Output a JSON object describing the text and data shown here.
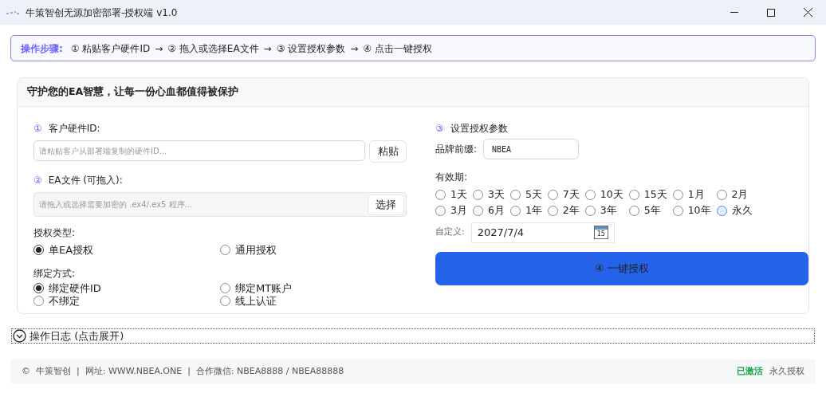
{
  "window": {
    "title": "牛策智创无源加密部署-授权端 v1.0"
  },
  "steps": {
    "label": "操作步骤:",
    "items": [
      "① 粘贴客户硬件ID",
      "→",
      "② 拖入或选择EA文件",
      "→",
      "③ 设置授权参数",
      "→",
      "④ 点击一键授权"
    ]
  },
  "card": {
    "title": "守护您的EA智慧，让每一份心血都值得被保护"
  },
  "hardware_id": {
    "number": "①",
    "label": "客户硬件ID:",
    "placeholder": "请粘贴客户从部署端复制的硬件ID...",
    "button": "粘贴"
  },
  "ea_file": {
    "number": "②",
    "label": "EA文件 (可拖入):",
    "placeholder": "请拖入或选择需要加密的 .ex4/.ex5 程序...",
    "button": "选择"
  },
  "license_type": {
    "label": "授权类型:",
    "options": [
      {
        "label": "单EA授权",
        "selected": true
      },
      {
        "label": "通用授权",
        "selected": false
      }
    ]
  },
  "binding": {
    "label": "绑定方式:",
    "options": [
      {
        "label": "绑定硬件ID",
        "selected": true
      },
      {
        "label": "绑定MT账户",
        "selected": false
      },
      {
        "label": "不绑定",
        "selected": false
      },
      {
        "label": "线上认证",
        "selected": false
      }
    ]
  },
  "params": {
    "number": "③",
    "label": "设置授权参数",
    "brand_label": "品牌前缀:",
    "brand_value": "NBEA"
  },
  "validity": {
    "label": "有效期:",
    "options": [
      {
        "label": "1天",
        "selected": false,
        "focused": false
      },
      {
        "label": "3天",
        "selected": false,
        "focused": false
      },
      {
        "label": "5天",
        "selected": false,
        "focused": false
      },
      {
        "label": "7天",
        "selected": false,
        "focused": false
      },
      {
        "label": "10天",
        "selected": false,
        "focused": false
      },
      {
        "label": "15天",
        "selected": false,
        "focused": false
      },
      {
        "label": "1月",
        "selected": false,
        "focused": false
      },
      {
        "label": "2月",
        "selected": false,
        "focused": false
      },
      {
        "label": "3月",
        "selected": false,
        "focused": false
      },
      {
        "label": "6月",
        "selected": false,
        "focused": false
      },
      {
        "label": "1年",
        "selected": false,
        "focused": false
      },
      {
        "label": "2年",
        "selected": false,
        "focused": false
      },
      {
        "label": "3年",
        "selected": false,
        "focused": false
      },
      {
        "label": "5年",
        "selected": false,
        "focused": false
      },
      {
        "label": "10年",
        "selected": false,
        "focused": false
      },
      {
        "label": "永久",
        "selected": false,
        "focused": true
      }
    ]
  },
  "custom": {
    "label": "自定义:",
    "value": "2027/7/4",
    "calendar_day": "15"
  },
  "authorize_button": "④ 一键授权",
  "log": {
    "label": "操作日志 (点击展开)",
    "expanded": false
  },
  "footer": {
    "text": "©  牛策智创  |  网址: WWW.NBEA.ONE  |  合作微信: NBEA8888 / NBEA88888",
    "status": "已激活",
    "license": "永久授权"
  }
}
